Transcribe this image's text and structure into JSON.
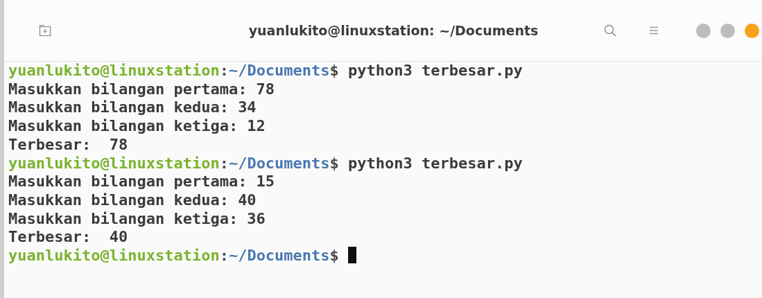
{
  "window": {
    "title": "yuanlukito@linuxstation: ~/Documents"
  },
  "terminal": {
    "lines": [
      {
        "kind": "prompt",
        "user_host": "yuanlukito@linuxstation",
        "separator": ":",
        "path": "~/Documents",
        "symbol": "$",
        "command": "python3 terbesar.py"
      },
      {
        "kind": "output",
        "text": "Masukkan bilangan pertama: 78"
      },
      {
        "kind": "output",
        "text": "Masukkan bilangan kedua: 34"
      },
      {
        "kind": "output",
        "text": "Masukkan bilangan ketiga: 12"
      },
      {
        "kind": "output",
        "text": "Terbesar:  78"
      },
      {
        "kind": "prompt",
        "user_host": "yuanlukito@linuxstation",
        "separator": ":",
        "path": "~/Documents",
        "symbol": "$",
        "command": "python3 terbesar.py"
      },
      {
        "kind": "output",
        "text": "Masukkan bilangan pertama: 15"
      },
      {
        "kind": "output",
        "text": "Masukkan bilangan kedua: 40"
      },
      {
        "kind": "output",
        "text": "Masukkan bilangan ketiga: 36"
      },
      {
        "kind": "output",
        "text": "Terbesar:  40"
      },
      {
        "kind": "prompt",
        "user_host": "yuanlukito@linuxstation",
        "separator": ":",
        "path": "~/Documents",
        "symbol": "$",
        "cursor": true
      }
    ]
  }
}
